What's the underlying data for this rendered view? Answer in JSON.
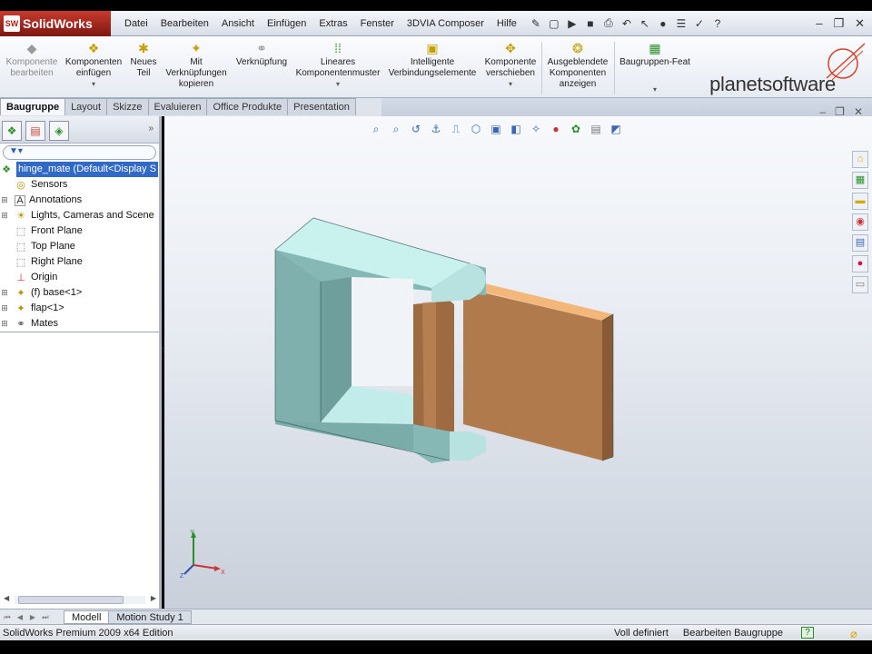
{
  "app": {
    "name": "SolidWorks",
    "logo_mark": "SW"
  },
  "menu": [
    "Datei",
    "Bearbeiten",
    "Ansicht",
    "Einfügen",
    "Extras",
    "Fenster",
    "3DVIA Composer",
    "Hilfe"
  ],
  "ribbon": {
    "buttons": [
      {
        "label": "Komponente bearbeiten",
        "icon": "edit-component-icon",
        "disabled": true
      },
      {
        "label": "Komponenten einfügen",
        "icon": "insert-components-icon",
        "dropdown": true
      },
      {
        "label": "Neues Teil",
        "icon": "new-part-icon"
      },
      {
        "label": "Mit Verknüpfungen kopieren",
        "icon": "copy-with-mates-icon"
      },
      {
        "label": "Verknüpfung",
        "icon": "mate-icon"
      },
      {
        "label": "Lineares Komponentenmuster",
        "icon": "linear-pattern-icon",
        "dropdown": true
      },
      {
        "label": "Intelligente Verbindungselemente",
        "icon": "smart-fasteners-icon"
      },
      {
        "label": "Komponente verschieben",
        "icon": "move-component-icon",
        "dropdown": true
      },
      {
        "label": "Ausgeblendete Komponenten anzeigen",
        "icon": "show-hidden-icon"
      },
      {
        "label": "Baugruppen-Feat",
        "icon": "assembly-features-icon",
        "dropdown": true
      }
    ],
    "brand": "planetsoftware"
  },
  "tabs": [
    "Baugruppe",
    "Layout",
    "Skizze",
    "Evaluieren",
    "Office Produkte",
    "Presentation"
  ],
  "active_tab": "Baugruppe",
  "tree": {
    "root": "hinge_mate  (Default<Display S",
    "items": [
      {
        "label": "Sensors",
        "icon": "sensor-icon",
        "expandable": false
      },
      {
        "label": "Annotations",
        "icon": "annotations-icon",
        "expandable": true
      },
      {
        "label": "Lights, Cameras and Scene",
        "icon": "lights-icon",
        "expandable": true
      },
      {
        "label": "Front Plane",
        "icon": "plane-icon",
        "expandable": false
      },
      {
        "label": "Top Plane",
        "icon": "plane-icon",
        "expandable": false
      },
      {
        "label": "Right Plane",
        "icon": "plane-icon",
        "expandable": false
      },
      {
        "label": "Origin",
        "icon": "origin-icon",
        "expandable": false
      },
      {
        "label": "(f) base<1>",
        "icon": "part-icon",
        "expandable": true
      },
      {
        "label": "flap<1>",
        "icon": "part-icon",
        "expandable": true
      },
      {
        "label": "Mates",
        "icon": "mates-icon",
        "expandable": true
      }
    ]
  },
  "bottom_tabs": [
    "Modell",
    "Motion Study 1"
  ],
  "active_bottom_tab": "Modell",
  "status": {
    "edition": "SolidWorks Premium 2009 x64 Edition",
    "state": "Voll definiert",
    "mode": "Bearbeiten Baugruppe"
  },
  "colors": {
    "base_part": "#a9dcd8",
    "flap_part": "#b07a4c",
    "selection": "#3169c6",
    "title_red": "#b32016"
  }
}
